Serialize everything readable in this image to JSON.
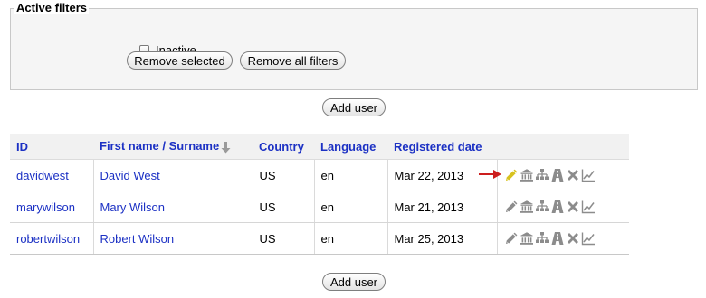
{
  "filters": {
    "legend": "Active filters",
    "inactive_label": "Inactive",
    "inactive_checked": false,
    "remove_selected_label": "Remove selected",
    "remove_all_label": "Remove all filters"
  },
  "add_user_label": "Add user",
  "table": {
    "headers": {
      "id": "ID",
      "name": "First name / Surname",
      "country": "Country",
      "language": "Language",
      "registered": "Registered date"
    },
    "rows": [
      {
        "id": "davidwest",
        "name": "David West",
        "country": "US",
        "language": "en",
        "registered": "Mar 22, 2013"
      },
      {
        "id": "marywilson",
        "name": "Mary Wilson",
        "country": "US",
        "language": "en",
        "registered": "Mar 21, 2013"
      },
      {
        "id": "robertwilson",
        "name": "Robert Wilson",
        "country": "US",
        "language": "en",
        "registered": "Mar 25, 2013"
      }
    ]
  },
  "row_actions": [
    "edit-pencil-icon",
    "institution-icon",
    "hierarchy-icon",
    "road-icon",
    "delete-x-icon",
    "statistics-chart-icon"
  ],
  "colors": {
    "link": "#1c31c4",
    "header_bg": "#f1f1f1",
    "icon_gray": "#8c8c8c",
    "pencil_highlight": "#d7c21e",
    "pointer_arrow": "#cc1e1e"
  }
}
